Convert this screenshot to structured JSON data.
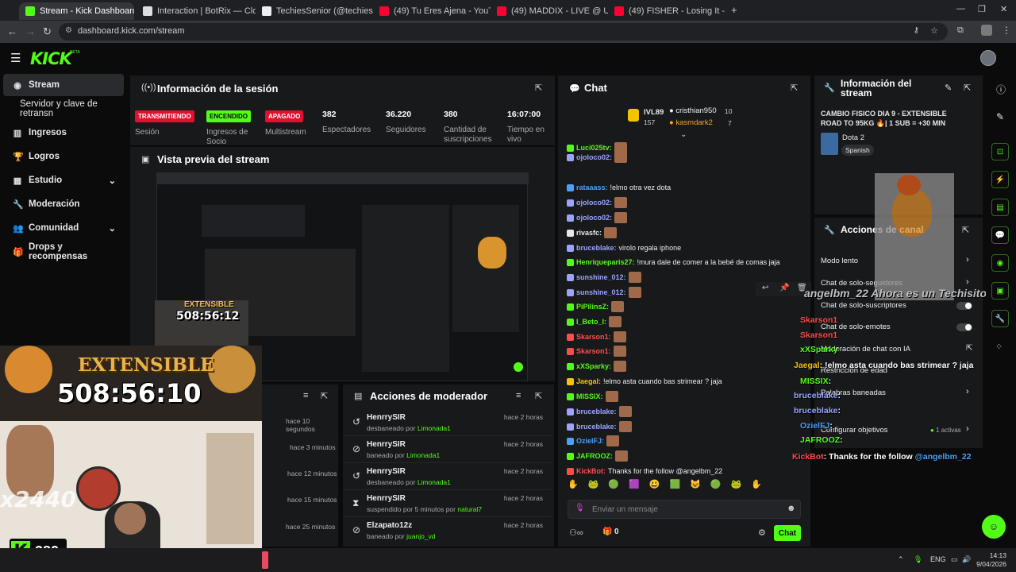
{
  "browser": {
    "tabs": [
      {
        "label": "Stream - Kick Dashboard",
        "color": "#53fc18"
      },
      {
        "label": "Interaction | BotRix — Cloud St",
        "color": "#ffffff"
      },
      {
        "label": "TechiesSenior (@techiessenior_",
        "color": "#ffffff"
      },
      {
        "label": "(49) Tu Eres Ajena - YouTube",
        "color": "#ff0033"
      },
      {
        "label": "(49) MADDIX - LIVE @ ULTRA M",
        "color": "#ff0033"
      },
      {
        "label": "(49) FISHER - Losing It - En viv",
        "color": "#ff0033"
      }
    ],
    "url": "dashboard.kick.com/stream"
  },
  "header": {
    "logo": "KICK",
    "logo_sup": "BETA"
  },
  "sidebar": {
    "items": [
      {
        "label": "Stream",
        "icon": "broadcast-icon"
      },
      {
        "label": "Servidor y clave de retransn",
        "icon": ""
      },
      {
        "label": "Ingresos",
        "icon": "chart-icon"
      },
      {
        "label": "Logros",
        "icon": "trophy-icon"
      },
      {
        "label": "Estudio",
        "icon": "grid-icon"
      },
      {
        "label": "Moderación",
        "icon": "wrench-icon"
      },
      {
        "label": "Comunidad",
        "icon": "users-icon"
      },
      {
        "label": "Drops y recompensas",
        "icon": "gift-icon"
      }
    ]
  },
  "session": {
    "title": "Información de la sesión",
    "badges": [
      {
        "text": "TRANSMITIENDO",
        "label": "Sesión",
        "color": "#e0102e"
      },
      {
        "text": "ENCENDIDO",
        "label": "Ingresos de Socio",
        "color": "#53fc18"
      },
      {
        "text": "APAGADO",
        "label": "Multistream",
        "color": "#e0102e"
      }
    ],
    "stats": [
      {
        "value": "382",
        "label": "Espectadores"
      },
      {
        "value": "36.220",
        "label": "Seguidores"
      },
      {
        "value": "380",
        "label": "Cantidad de suscripciones"
      },
      {
        "value": "16:07:00",
        "label": "Tiempo en vivo"
      }
    ]
  },
  "preview": {
    "title": "Vista previa del stream"
  },
  "activity": {
    "times": [
      "hace 10 segundos",
      "hace 3 minutos",
      "hace 12 minutos",
      "hace 15 minutos",
      "hace 25 minutos"
    ]
  },
  "modactions": {
    "title": "Acciones de moderador",
    "rows": [
      {
        "user": "HenrrySIR",
        "desc": "desbaneado por",
        "by": "Limonada1",
        "time": "hace 2 horas",
        "icon": "undo-icon"
      },
      {
        "user": "HenrrySIR",
        "desc": "baneado por",
        "by": "Limonada1",
        "time": "hace 2 horas",
        "icon": "ban-icon"
      },
      {
        "user": "HenrrySIR",
        "desc": "desbaneado por",
        "by": "Limonada1",
        "time": "hace 2 horas",
        "icon": "undo-icon"
      },
      {
        "user": "HenrrySIR",
        "desc": "suspendido por 5 minutos por",
        "by": "natural7",
        "time": "hace 2 horas",
        "icon": "hourglass-icon"
      },
      {
        "user": "Elzapato12z",
        "desc": "baneado por",
        "by": "juanjo_vd",
        "time": "hace 2 horas",
        "icon": "ban-icon"
      }
    ]
  },
  "chat": {
    "title": "Chat",
    "leaders": {
      "rank_name": "IVL89",
      "rank_val": "157",
      "u1": "cristhian950",
      "u1v": "10",
      "u2": "kasmdark2",
      "u2v": "7"
    },
    "messages": [
      {
        "user": "Luci025tv:",
        "text": "",
        "color": "#53fc18"
      },
      {
        "user": "ojoloco02:",
        "text": "",
        "color": "#9aa4ff"
      },
      {
        "user": "rataaass:",
        "text": "!elmo otra vez dota",
        "color": "#4aa0ff"
      },
      {
        "user": "ojoloco02:",
        "text": "",
        "color": "#9aa4ff"
      },
      {
        "user": "ojoloco02:",
        "text": "",
        "color": "#9aa4ff"
      },
      {
        "user": "rivasfc:",
        "text": "",
        "color": "#e8e8e8"
      },
      {
        "user": "bruceblake:",
        "text": "virolo regala iphone",
        "color": "#9aa4ff"
      },
      {
        "user": "Henriqueparis27:",
        "text": "!mura dale de comer a la bebé de comas jaja",
        "color": "#53fc18"
      },
      {
        "user": "sunshine_012:",
        "text": "",
        "color": "#9aa4ff"
      },
      {
        "user": "sunshine_012:",
        "text": "",
        "color": "#9aa4ff"
      },
      {
        "user": "PiPilinsZ:",
        "text": "",
        "color": "#53fc18"
      },
      {
        "user": "I_Beto_I:",
        "text": "",
        "color": "#53fc18"
      },
      {
        "user": "Skarson1:",
        "text": "",
        "color": "#ff4d4d"
      },
      {
        "user": "Skarson1:",
        "text": "",
        "color": "#ff4d4d"
      },
      {
        "user": "xXSparky:",
        "text": "",
        "color": "#53fc18"
      },
      {
        "user": "Jaegal:",
        "text": "!elmo asta cuando bas strimear ? jaja",
        "color": "#f5c400"
      },
      {
        "user": "MISSIX:",
        "text": "",
        "color": "#53fc18"
      },
      {
        "user": "bruceblake:",
        "text": "",
        "color": "#9aa4ff"
      },
      {
        "user": "bruceblake:",
        "text": "",
        "color": "#9aa4ff"
      },
      {
        "user": "OzielFJ:",
        "text": "",
        "color": "#4aa0ff"
      },
      {
        "user": "JAFROOZ:",
        "text": "",
        "color": "#53fc18"
      },
      {
        "user": "KickBot:",
        "text": "Thanks for the follow @angelbm_22",
        "color": "#ff4d4d"
      }
    ],
    "input_placeholder": "Enviar un mensaje",
    "send_label": "Chat",
    "count": "0"
  },
  "streaminfo": {
    "title": "Información del stream",
    "stream_title": "CAMBIO FISICO DIA 9 - EXTENSIBLE ROAD TO 95KG 🔥| 1 SUB = +30 MIN",
    "category": "Dota 2",
    "tag": "Spanish"
  },
  "channelactions": {
    "title": "Acciones de canal",
    "rows": [
      "Modo lento",
      "Chat de solo-seguidores",
      "Chat de solo-suscriptores",
      "Chat de solo-emotes",
      "Moderación de chat con IA",
      "Restricción de edad",
      "Palabras baneadas",
      "Configurar objetivos"
    ],
    "goals_badge": "1 activas"
  },
  "overlay": {
    "small_timer": "508:56:12",
    "big_timer": "508:56:10",
    "label": "EXTENSIBLE",
    "combo": "x2440",
    "viewers": "382",
    "banner": "angelbm_22 Ahora es un Techisito"
  },
  "overlay_chat": [
    {
      "user": "Skarson1",
      "text": "",
      "color": "#ff4d4d"
    },
    {
      "user": "Skarson1",
      "text": "",
      "color": "#ff4d4d"
    },
    {
      "user": "xXSparky",
      "text": "",
      "color": "#53fc18"
    },
    {
      "user": "Jaegal",
      "text": ": !elmo asta cuando bas strimear ? jaja",
      "color": "#f5c400"
    },
    {
      "user": "MISSIX",
      "text": ":",
      "color": "#53fc18"
    },
    {
      "user": "bruceblake",
      "text": ":",
      "color": "#9aa4ff"
    },
    {
      "user": "bruceblake",
      "text": ":",
      "color": "#9aa4ff"
    },
    {
      "user": "OzielFJ",
      "text": ":",
      "color": "#4aa0ff"
    },
    {
      "user": "JAFROOZ",
      "text": ":",
      "color": "#53fc18"
    },
    {
      "user": "KickBot",
      "text": ": Thanks for the follow",
      "mention": "@angelbm_22",
      "color": "#ff4d4d"
    }
  ],
  "taskbar": {
    "lang": "ENG",
    "time": "14:13",
    "date": "9/04/2026"
  }
}
